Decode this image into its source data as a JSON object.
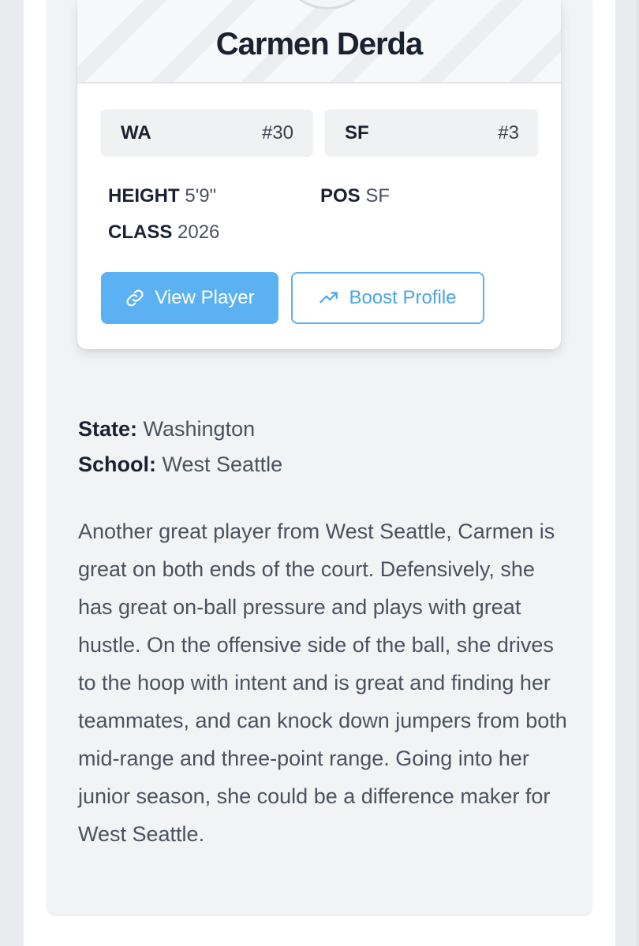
{
  "player": {
    "name": "Carmen Derda",
    "state_badge": {
      "abbr": "WA",
      "rank": "#30"
    },
    "position_badge": {
      "abbr": "SF",
      "rank": "#3"
    },
    "height_label": "HEIGHT",
    "height_value": "5'9\"",
    "pos_label": "POS",
    "pos_value": "SF",
    "class_label": "CLASS",
    "class_value": "2026",
    "buttons": {
      "view": {
        "label": "View Player",
        "icon": "link-icon"
      },
      "boost": {
        "label": "Boost Profile",
        "icon": "trending-up-icon"
      }
    }
  },
  "details": {
    "state_label": "State:",
    "state_value": "Washington",
    "school_label": "School:",
    "school_value": "West Seattle"
  },
  "bio": "Another great player from West Seattle, Carmen is great on both ends of the court. Defensively, she has great on-ball pressure and plays with great hustle. On the offensive side of the ball, she drives to the hoop with intent and is great and finding her teammates, and can knock down jumpers from both mid-range and three-point range. Going into her junior season, she could be a difference maker for West Seattle.",
  "colors": {
    "accent": "#5cb1f3",
    "text_dark": "#1a2130",
    "text_body": "#4a5260",
    "panel_bg": "#f2f3f5"
  }
}
